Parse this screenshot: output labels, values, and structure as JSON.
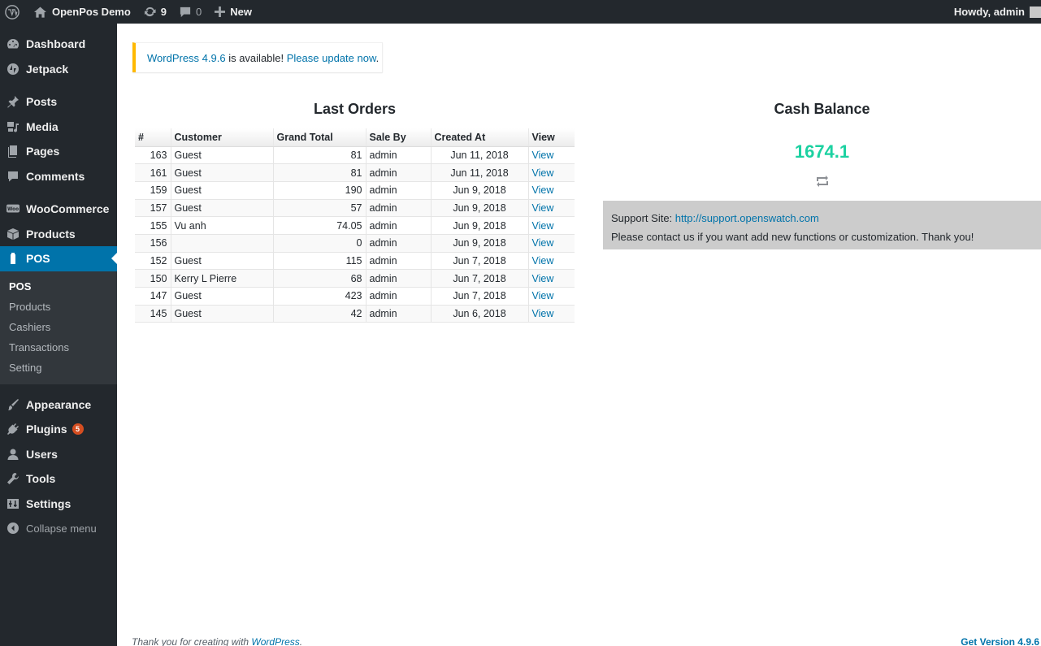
{
  "adminbar": {
    "site_name": "OpenPos Demo",
    "updates_count": "9",
    "comments_count": "0",
    "new_label": "New",
    "howdy": "Howdy, admin"
  },
  "sidebar": {
    "items": [
      {
        "label": "Dashboard",
        "icon": "dashboard-icon"
      },
      {
        "label": "Jetpack",
        "icon": "jetpack-icon"
      },
      {
        "label": "Posts",
        "icon": "pin-icon"
      },
      {
        "label": "Media",
        "icon": "media-icon"
      },
      {
        "label": "Pages",
        "icon": "pages-icon"
      },
      {
        "label": "Comments",
        "icon": "comment-icon"
      },
      {
        "label": "WooCommerce",
        "icon": "woo-icon"
      },
      {
        "label": "Products",
        "icon": "box-icon"
      },
      {
        "label": "POS",
        "icon": "pos-icon"
      },
      {
        "label": "Appearance",
        "icon": "brush-icon"
      },
      {
        "label": "Plugins",
        "icon": "plug-icon",
        "badge": "5"
      },
      {
        "label": "Users",
        "icon": "user-icon"
      },
      {
        "label": "Tools",
        "icon": "wrench-icon"
      },
      {
        "label": "Settings",
        "icon": "sliders-icon"
      },
      {
        "label": "Collapse menu",
        "icon": "collapse-icon"
      }
    ],
    "submenu": [
      "POS",
      "Products",
      "Cashiers",
      "Transactions",
      "Setting"
    ]
  },
  "notice": {
    "version_link": "WordPress 4.9.6",
    "text": " is available! ",
    "update_link": "Please update now",
    "period": "."
  },
  "orders": {
    "title": "Last Orders",
    "columns": [
      "#",
      "Customer",
      "Grand Total",
      "Sale By",
      "Created At",
      "View"
    ],
    "rows": [
      {
        "id": "163",
        "customer": "Guest",
        "total": "81",
        "by": "admin",
        "date": "Jun 11, 2018",
        "view": "View"
      },
      {
        "id": "161",
        "customer": "Guest",
        "total": "81",
        "by": "admin",
        "date": "Jun 11, 2018",
        "view": "View"
      },
      {
        "id": "159",
        "customer": "Guest",
        "total": "190",
        "by": "admin",
        "date": "Jun 9, 2018",
        "view": "View"
      },
      {
        "id": "157",
        "customer": "Guest",
        "total": "57",
        "by": "admin",
        "date": "Jun 9, 2018",
        "view": "View"
      },
      {
        "id": "155",
        "customer": "Vu anh",
        "total": "74.05",
        "by": "admin",
        "date": "Jun 9, 2018",
        "view": "View"
      },
      {
        "id": "156",
        "customer": "",
        "total": "0",
        "by": "admin",
        "date": "Jun 9, 2018",
        "view": "View"
      },
      {
        "id": "152",
        "customer": "Guest",
        "total": "115",
        "by": "admin",
        "date": "Jun 7, 2018",
        "view": "View"
      },
      {
        "id": "150",
        "customer": "Kerry L Pierre",
        "total": "68",
        "by": "admin",
        "date": "Jun 7, 2018",
        "view": "View"
      },
      {
        "id": "147",
        "customer": "Guest",
        "total": "423",
        "by": "admin",
        "date": "Jun 7, 2018",
        "view": "View"
      },
      {
        "id": "145",
        "customer": "Guest",
        "total": "42",
        "by": "admin",
        "date": "Jun 6, 2018",
        "view": "View"
      }
    ]
  },
  "cash": {
    "title": "Cash Balance",
    "value": "1674.1",
    "value_color": "#1cd1a1"
  },
  "support": {
    "label": "Support Site: ",
    "link": "http://support.openswatch.com",
    "message": "Please contact us if you want add new functions or customization. Thank you!"
  },
  "footer": {
    "thanks": "Thank you for creating with ",
    "wp_link": "WordPress",
    "period": ".",
    "version": "Get Version 4.9.6"
  },
  "colors": {
    "admin_bg": "#23282d",
    "accent": "#0073aa",
    "notice_border": "#ffb900",
    "badge": "#d54e21"
  }
}
